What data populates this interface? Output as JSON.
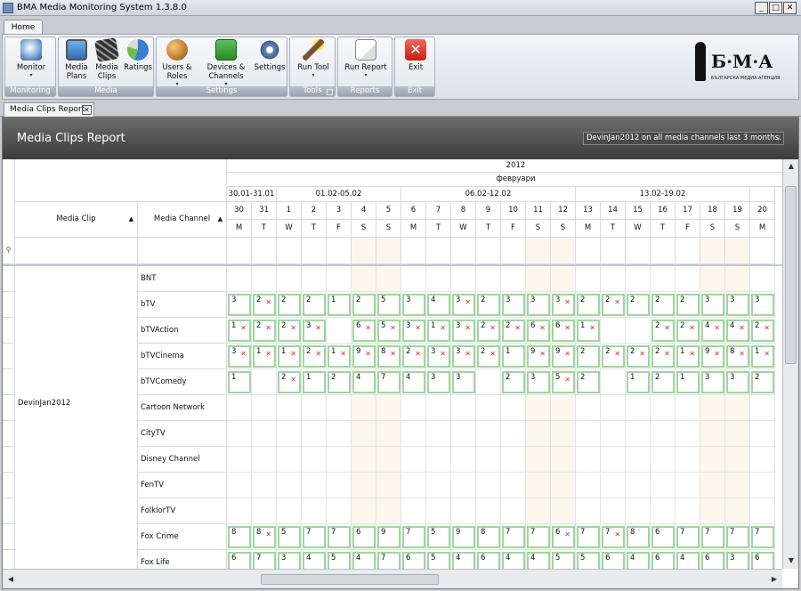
{
  "window": {
    "title": "BMA Media Monitoring System 1.3.8.0"
  },
  "ribbon": {
    "tab": "Home",
    "groups": [
      {
        "label": "Monitoring",
        "buttons": [
          {
            "label": "Monitor",
            "dropdown": true
          }
        ]
      },
      {
        "label": "Media",
        "buttons": [
          {
            "label": "Media\nPlans"
          },
          {
            "label": "Media\nClips"
          },
          {
            "label": "Ratings"
          }
        ]
      },
      {
        "label": "Settings",
        "buttons": [
          {
            "label": "Users &\nRoles",
            "dropdown": true
          },
          {
            "label": "Devices &\nChannels",
            "dropdown": true
          },
          {
            "label": "Settings"
          }
        ]
      },
      {
        "label": "Tools",
        "buttons": [
          {
            "label": "Run Tool",
            "dropdown": true
          }
        ]
      },
      {
        "label": "Reports",
        "buttons": [
          {
            "label": "Run Report",
            "dropdown": true
          }
        ]
      },
      {
        "label": "Exit",
        "buttons": [
          {
            "label": "Exit"
          }
        ]
      }
    ],
    "logo_text": "Б·М·А",
    "logo_sub": "БЪЛГАРСКА МЕДИА АГЕНЦИЯ"
  },
  "doc_tab": {
    "label": "Media Clips Report"
  },
  "report": {
    "title": "Media Clips Report",
    "filter": "DevinJan2012 on all media channels last 3 months.",
    "year": "2012",
    "month": "февруари",
    "weeks": [
      {
        "label": "30.01-31.01",
        "span": 2
      },
      {
        "label": "01.02-05.02",
        "span": 5
      },
      {
        "label": "06.02-12.02",
        "span": 7
      },
      {
        "label": "13.02-19.02",
        "span": 7
      },
      {
        "label": "",
        "span": 1
      }
    ],
    "col_media_clip": "Media Clip",
    "col_media_channel": "Media Channel",
    "days": [
      {
        "d": "30",
        "w": "M"
      },
      {
        "d": "31",
        "w": "T"
      },
      {
        "d": "1",
        "w": "W"
      },
      {
        "d": "2",
        "w": "T"
      },
      {
        "d": "3",
        "w": "F"
      },
      {
        "d": "4",
        "w": "S"
      },
      {
        "d": "5",
        "w": "S"
      },
      {
        "d": "6",
        "w": "M"
      },
      {
        "d": "7",
        "w": "T"
      },
      {
        "d": "8",
        "w": "W"
      },
      {
        "d": "9",
        "w": "T"
      },
      {
        "d": "10",
        "w": "F"
      },
      {
        "d": "11",
        "w": "S"
      },
      {
        "d": "12",
        "w": "S"
      },
      {
        "d": "13",
        "w": "M"
      },
      {
        "d": "14",
        "w": "T"
      },
      {
        "d": "15",
        "w": "W"
      },
      {
        "d": "16",
        "w": "T"
      },
      {
        "d": "17",
        "w": "F"
      },
      {
        "d": "18",
        "w": "S"
      },
      {
        "d": "19",
        "w": "S"
      },
      {
        "d": "20",
        "w": "M"
      }
    ],
    "clip": "DevinJan2012",
    "rows": [
      {
        "channel": "BNT",
        "cells": []
      },
      {
        "channel": "bTV",
        "cells": [
          [
            "3",
            0
          ],
          [
            "2",
            1
          ],
          [
            "2",
            0
          ],
          [
            "2",
            0
          ],
          [
            "1",
            0
          ],
          [
            "2",
            0
          ],
          [
            "5",
            0
          ],
          [
            "3",
            0
          ],
          [
            "4",
            0
          ],
          [
            "3",
            1
          ],
          [
            "2",
            0
          ],
          [
            "3",
            0
          ],
          [
            "3",
            0
          ],
          [
            "3",
            1
          ],
          [
            "2",
            0
          ],
          [
            "2",
            1
          ],
          [
            "2",
            0
          ],
          [
            "2",
            0
          ],
          [
            "2",
            0
          ],
          [
            "3",
            0
          ],
          [
            "3",
            0
          ],
          [
            "3",
            0
          ]
        ]
      },
      {
        "channel": "bTVAction",
        "cells": [
          [
            "1",
            1
          ],
          [
            "2",
            1
          ],
          [
            "2",
            1
          ],
          [
            "3",
            1
          ],
          null,
          [
            "6",
            1
          ],
          [
            "5",
            1
          ],
          [
            "3",
            1
          ],
          [
            "1",
            1
          ],
          [
            "3",
            1
          ],
          [
            "2",
            1
          ],
          [
            "2",
            1
          ],
          [
            "6",
            1
          ],
          [
            "6",
            1
          ],
          [
            "1",
            1
          ],
          null,
          null,
          [
            "2",
            1
          ],
          [
            "2",
            1
          ],
          [
            "4",
            1
          ],
          [
            "4",
            1
          ],
          [
            "2",
            1
          ]
        ]
      },
      {
        "channel": "bTVCinema",
        "cells": [
          [
            "3",
            1
          ],
          [
            "1",
            1
          ],
          [
            "1",
            1
          ],
          [
            "2",
            1
          ],
          [
            "1",
            1
          ],
          [
            "9",
            1
          ],
          [
            "8",
            1
          ],
          [
            "2",
            1
          ],
          [
            "3",
            1
          ],
          [
            "3",
            1
          ],
          [
            "2",
            1
          ],
          [
            "1",
            0
          ],
          [
            "9",
            1
          ],
          [
            "9",
            1
          ],
          [
            "2",
            0
          ],
          [
            "2",
            1
          ],
          [
            "2",
            1
          ],
          [
            "2",
            1
          ],
          [
            "1",
            1
          ],
          [
            "9",
            1
          ],
          [
            "8",
            1
          ],
          [
            "1",
            1
          ]
        ]
      },
      {
        "channel": "bTVComedy",
        "cells": [
          [
            "1",
            0
          ],
          null,
          [
            "2",
            1
          ],
          [
            "1",
            0
          ],
          [
            "2",
            0
          ],
          [
            "4",
            0
          ],
          [
            "7",
            0
          ],
          [
            "4",
            0
          ],
          [
            "3",
            0
          ],
          [
            "3",
            0
          ],
          null,
          [
            "2",
            0
          ],
          [
            "3",
            0
          ],
          [
            "5",
            1
          ],
          [
            "2",
            0
          ],
          null,
          [
            "1",
            0
          ],
          [
            "2",
            0
          ],
          [
            "1",
            0
          ],
          [
            "3",
            0
          ],
          [
            "3",
            0
          ],
          [
            "2",
            0
          ]
        ]
      },
      {
        "channel": "Cartoon Network",
        "cells": []
      },
      {
        "channel": "CityTV",
        "cells": []
      },
      {
        "channel": "Disney Channel",
        "cells": []
      },
      {
        "channel": "FenTV",
        "cells": []
      },
      {
        "channel": "FolklorTV",
        "cells": []
      },
      {
        "channel": "Fox Crime",
        "cells": [
          [
            "8",
            0
          ],
          [
            "8",
            1
          ],
          [
            "5",
            0
          ],
          [
            "7",
            0
          ],
          [
            "7",
            0
          ],
          [
            "6",
            0
          ],
          [
            "9",
            0
          ],
          [
            "7",
            0
          ],
          [
            "5",
            0
          ],
          [
            "9",
            0
          ],
          [
            "8",
            0
          ],
          [
            "7",
            0
          ],
          [
            "7",
            0
          ],
          [
            "6",
            1
          ],
          [
            "7",
            0
          ],
          [
            "7",
            1
          ],
          [
            "8",
            0
          ],
          [
            "6",
            0
          ],
          [
            "7",
            0
          ],
          [
            "7",
            0
          ],
          [
            "7",
            0
          ],
          [
            "7",
            0
          ]
        ]
      },
      {
        "channel": "Fox Life",
        "cells": [
          [
            "6",
            0
          ],
          [
            "7",
            0
          ],
          [
            "3",
            0
          ],
          [
            "4",
            0
          ],
          [
            "5",
            0
          ],
          [
            "4",
            0
          ],
          [
            "7",
            0
          ],
          [
            "6",
            0
          ],
          [
            "5",
            0
          ],
          [
            "4",
            0
          ],
          [
            "6",
            0
          ],
          [
            "4",
            0
          ],
          [
            "4",
            0
          ],
          [
            "5",
            0
          ],
          [
            "5",
            0
          ],
          [
            "6",
            0
          ],
          [
            "4",
            0
          ],
          [
            "6",
            0
          ],
          [
            "4",
            0
          ],
          [
            "6",
            0
          ],
          [
            "3",
            0
          ],
          [
            "6",
            0
          ]
        ]
      }
    ]
  }
}
